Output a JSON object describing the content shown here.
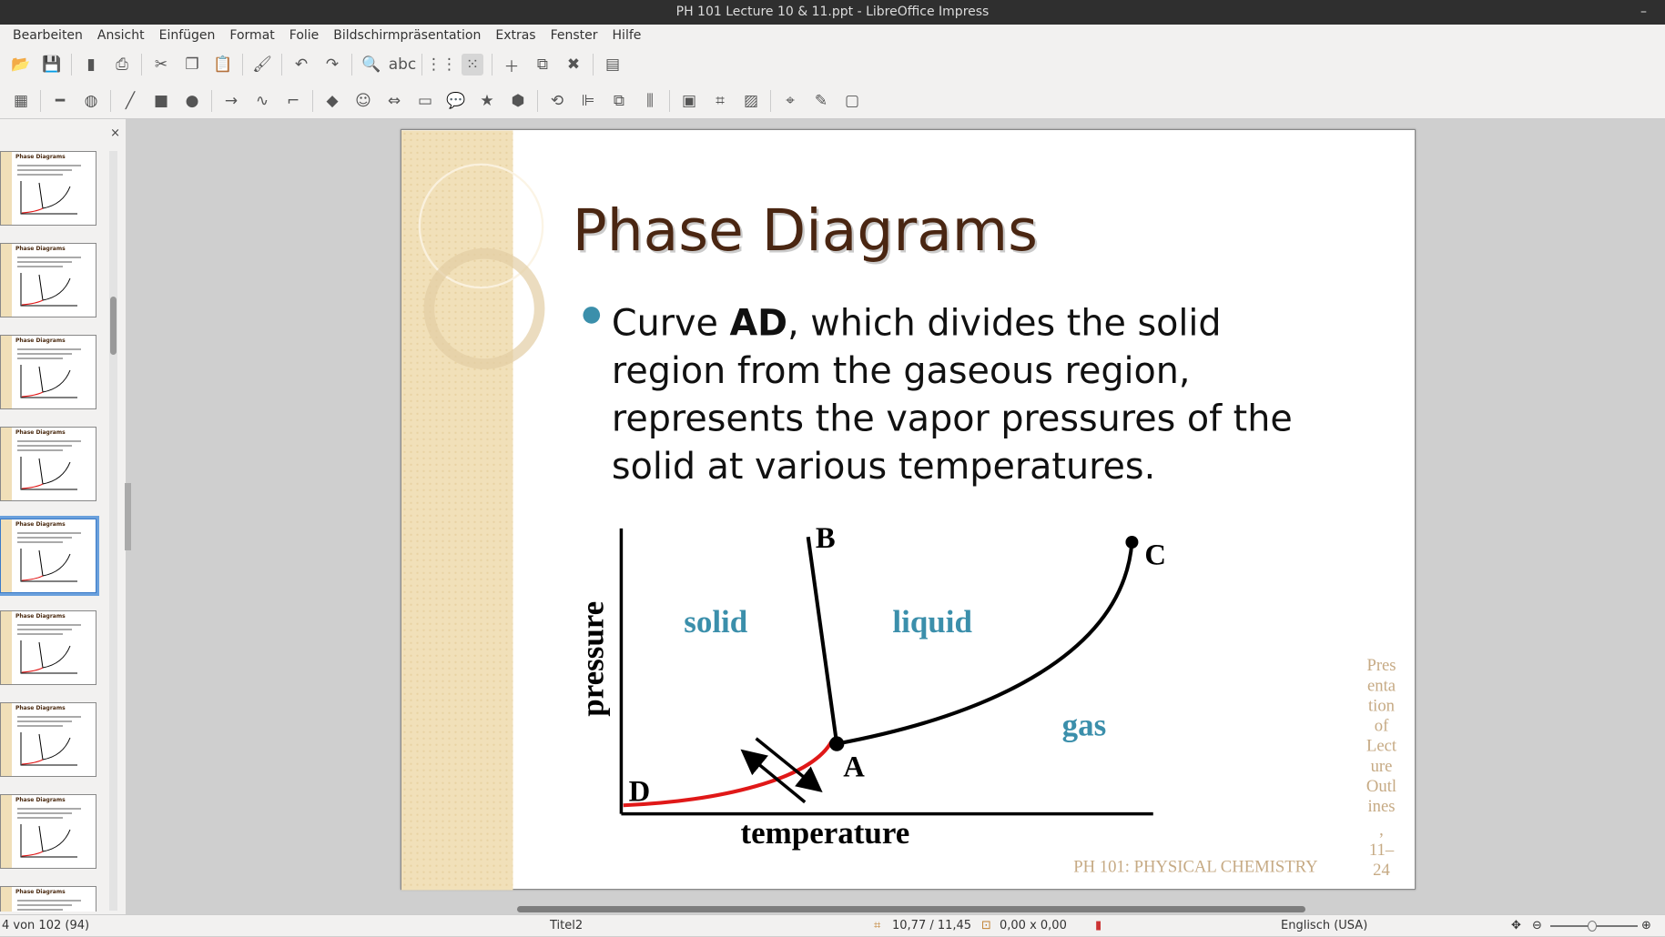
{
  "window": {
    "title": "PH 101 Lecture 10 & 11.ppt - LibreOffice Impress",
    "minimize": "–"
  },
  "menu": [
    "Bearbeiten",
    "Ansicht",
    "Einfügen",
    "Format",
    "Folie",
    "Bildschirmpräsentation",
    "Extras",
    "Fenster",
    "Hilfe"
  ],
  "toolbar1": [
    {
      "icon": "open-icon",
      "g": "📂"
    },
    {
      "icon": "save-icon",
      "g": "💾"
    },
    {
      "icon": "export-pdf-icon",
      "g": "▮"
    },
    {
      "icon": "print-icon",
      "g": "⎙"
    },
    {
      "icon": "cut-icon",
      "g": "✂"
    },
    {
      "icon": "copy-icon",
      "g": "❐"
    },
    {
      "icon": "paste-icon",
      "g": "📋"
    },
    {
      "icon": "clone-formatting-icon",
      "g": "🖌"
    },
    {
      "icon": "undo-icon",
      "g": "↶"
    },
    {
      "icon": "redo-icon",
      "g": "↷"
    },
    {
      "icon": "find-replace-icon",
      "g": "🔍"
    },
    {
      "icon": "spellcheck-icon",
      "g": "abc"
    },
    {
      "icon": "grid-icon",
      "g": "⋮⋮"
    },
    {
      "icon": "snap-guides-icon",
      "g": "⁙"
    },
    {
      "icon": "new-slide-icon",
      "g": "＋"
    },
    {
      "icon": "duplicate-slide-icon",
      "g": "⧉"
    },
    {
      "icon": "delete-slide-icon",
      "g": "✖"
    },
    {
      "icon": "slide-layout-icon",
      "g": "▤"
    }
  ],
  "toolbar2": [
    {
      "icon": "select-icon",
      "g": "▦"
    },
    {
      "icon": "line-color-icon",
      "g": "━"
    },
    {
      "icon": "fill-color-icon",
      "g": "◍"
    },
    {
      "icon": "line-icon",
      "g": "╱"
    },
    {
      "icon": "rectangle-icon",
      "g": "■"
    },
    {
      "icon": "ellipse-icon",
      "g": "●"
    },
    {
      "icon": "arrow-line-icon",
      "g": "→"
    },
    {
      "icon": "curve-icon",
      "g": "∿"
    },
    {
      "icon": "connector-icon",
      "g": "⌐"
    },
    {
      "icon": "basic-shapes-icon",
      "g": "◆"
    },
    {
      "icon": "symbol-shapes-icon",
      "g": "☺"
    },
    {
      "icon": "block-arrows-icon",
      "g": "⇔"
    },
    {
      "icon": "flowchart-icon",
      "g": "▭"
    },
    {
      "icon": "callout-icon",
      "g": "💬"
    },
    {
      "icon": "star-icon",
      "g": "★"
    },
    {
      "icon": "3d-objects-icon",
      "g": "⬢"
    },
    {
      "icon": "rotate-icon",
      "g": "⟲"
    },
    {
      "icon": "align-icon",
      "g": "⊫"
    },
    {
      "icon": "arrange-icon",
      "g": "⧉"
    },
    {
      "icon": "distribute-icon",
      "g": "⫼"
    },
    {
      "icon": "shadow-icon",
      "g": "▣"
    },
    {
      "icon": "crop-icon",
      "g": "⌗"
    },
    {
      "icon": "filter-icon",
      "g": "▨"
    },
    {
      "icon": "points-icon",
      "g": "⌖"
    },
    {
      "icon": "glue-points-icon",
      "g": "✎"
    },
    {
      "icon": "toggle-extrusion-icon",
      "g": "▢"
    }
  ],
  "panel": {
    "close": "×",
    "thumb_title": "Phase Diagrams",
    "selected_index": 4,
    "count": 9
  },
  "slide": {
    "title": "Phase Diagrams",
    "bullet_lines": [
      [
        "Curve ",
        "AD",
        ", which divides the solid"
      ],
      "region from the gaseous region,",
      "represents the vapor pressures of the",
      "solid at various temperatures."
    ],
    "diagram": {
      "label_B": "B",
      "label_C": "C",
      "label_A": "A",
      "label_D": "D",
      "region_solid": "solid",
      "region_liquid": "liquid",
      "region_gas": "gas",
      "ylabel": "pressure",
      "xlabel": "temperature"
    },
    "footer": "PH 101: PHYSICAL CHEMISTRY",
    "side_text": [
      "Pres",
      "enta",
      "tion",
      "of",
      "Lect",
      "ure",
      "Outl",
      "ines",
      ",",
      "11–",
      "24"
    ],
    "colors": {
      "accent": "#3b8fab",
      "title": "#4a2612",
      "footer": "#c6aa84",
      "curve_red": "#e01818",
      "strip": "#f0dfb8"
    }
  },
  "status": {
    "slide_pos": "4 von 102 (94)",
    "layout": "Titel2",
    "position": "10,77 / 11,45",
    "size": "0,00 x 0,00",
    "language": "Englisch (USA)"
  }
}
